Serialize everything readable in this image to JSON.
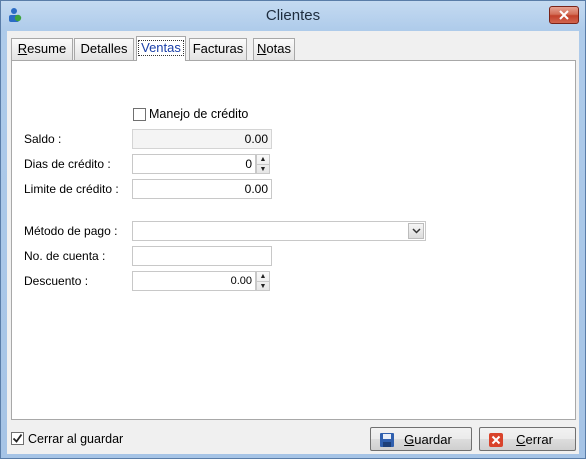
{
  "window": {
    "title": "Clientes"
  },
  "tabs": [
    {
      "label_first": "R",
      "label_rest": "esume"
    },
    {
      "label": "Detalles"
    },
    {
      "label": "Ventas"
    },
    {
      "label": "Facturas"
    },
    {
      "label_first": "N",
      "label_rest": "otas"
    }
  ],
  "ventas": {
    "manejo_credito": {
      "label": "Manejo de crédito",
      "checked": false
    },
    "saldo": {
      "label": "Saldo :",
      "value": "0.00"
    },
    "dias_credito": {
      "label": "Dias de crédito :",
      "value": "0"
    },
    "limite_credito": {
      "label": "Limite de crédito :",
      "value": "0.00"
    },
    "metodo_pago": {
      "label": "Método de pago :",
      "value": ""
    },
    "no_cuenta": {
      "label": "No. de cuenta :",
      "value": ""
    },
    "descuento": {
      "label": "Descuento :",
      "value": "0.00"
    }
  },
  "footer": {
    "cerrar_al_guardar": {
      "label": "Cerrar al guardar",
      "checked": true
    },
    "guardar_label_first": "G",
    "guardar_label_rest": "uardar",
    "cerrar_label_first": "C",
    "cerrar_label_rest": "errar"
  }
}
